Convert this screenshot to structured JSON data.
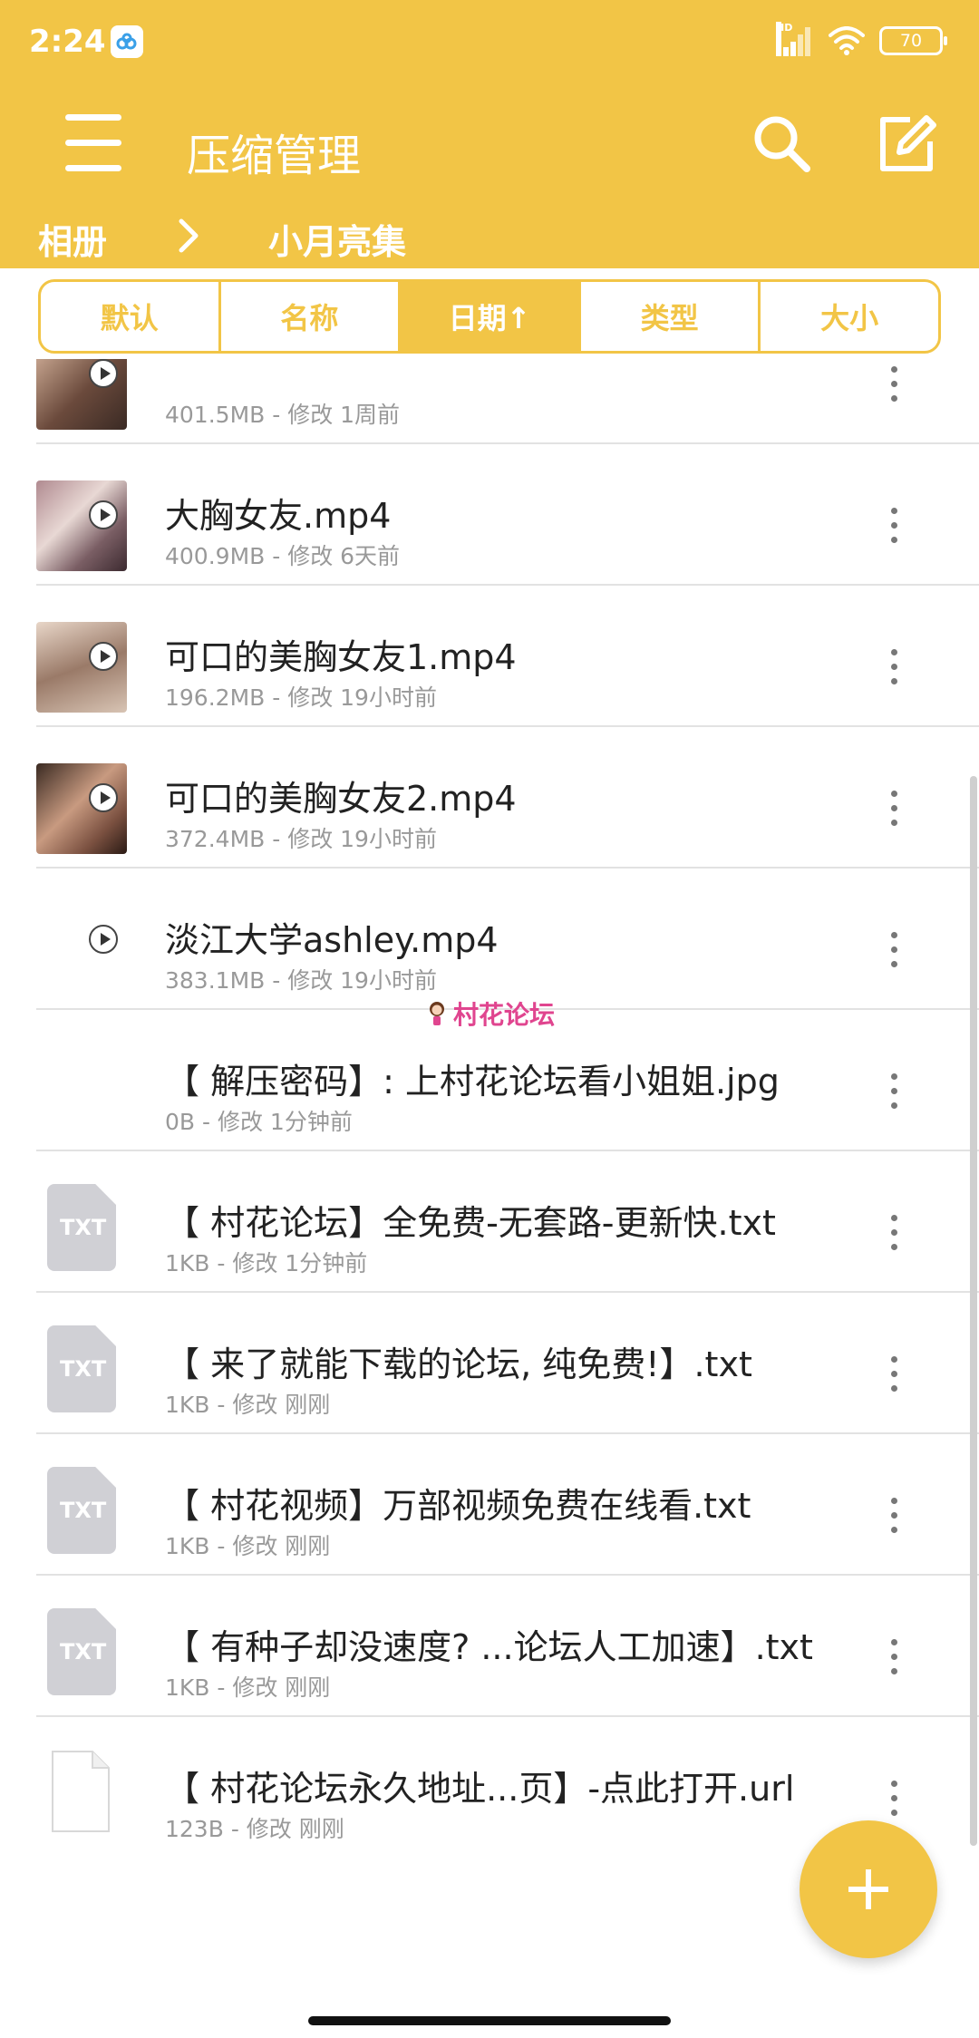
{
  "status_bar": {
    "time": "2:24",
    "network_label": "HD",
    "battery": "70"
  },
  "toolbar": {
    "title": "压缩管理"
  },
  "breadcrumb": {
    "items": [
      "相册",
      "小月亮集"
    ]
  },
  "sort_tabs": [
    {
      "label": "默认",
      "active": false
    },
    {
      "label": "名称",
      "active": false
    },
    {
      "label": "日期↑",
      "active": true
    },
    {
      "label": "类型",
      "active": false
    },
    {
      "label": "大小",
      "active": false
    }
  ],
  "files": [
    {
      "name": "",
      "meta": "401.5MB - 修改 1周前",
      "icon": "video-thumb"
    },
    {
      "name": "大胸女友.mp4",
      "meta": "400.9MB - 修改 6天前",
      "icon": "video-thumb"
    },
    {
      "name": "可口的美胸女友1.mp4",
      "meta": "196.2MB - 修改 19小时前",
      "icon": "video-thumb"
    },
    {
      "name": "可口的美胸女友2.mp4",
      "meta": "372.4MB - 修改 19小时前",
      "icon": "video-thumb"
    },
    {
      "name": "淡江大学ashley.mp4",
      "meta": "383.1MB - 修改 19小时前",
      "icon": "video-blank"
    },
    {
      "name": "【 解压密码】: 上村花论坛看小姐姐.jpg",
      "meta": "0B - 修改 1分钟前",
      "icon": "none"
    },
    {
      "name": "【 村花论坛】全免费-无套路-更新快.txt",
      "meta": "1KB - 修改 1分钟前",
      "icon": "txt"
    },
    {
      "name": "【 来了就能下载的论坛, 纯免费!】.txt",
      "meta": "1KB - 修改 刚刚",
      "icon": "txt"
    },
    {
      "name": "【 村花视频】万部视频免费在线看.txt",
      "meta": "1KB - 修改 刚刚",
      "icon": "txt"
    },
    {
      "name": "【 有种子却没速度? ...论坛人工加速】.txt",
      "meta": "1KB - 修改 刚刚",
      "icon": "txt"
    },
    {
      "name": "【 村花论坛永久地址...页】-点此打开.url",
      "meta": "123B - 修改 刚刚",
      "icon": "blank-file"
    }
  ],
  "txt_icon_label": "TXT",
  "watermark": "村花论坛",
  "colors": {
    "accent": "#F2C546",
    "meta_text": "#999999",
    "watermark": "#e0458f"
  }
}
